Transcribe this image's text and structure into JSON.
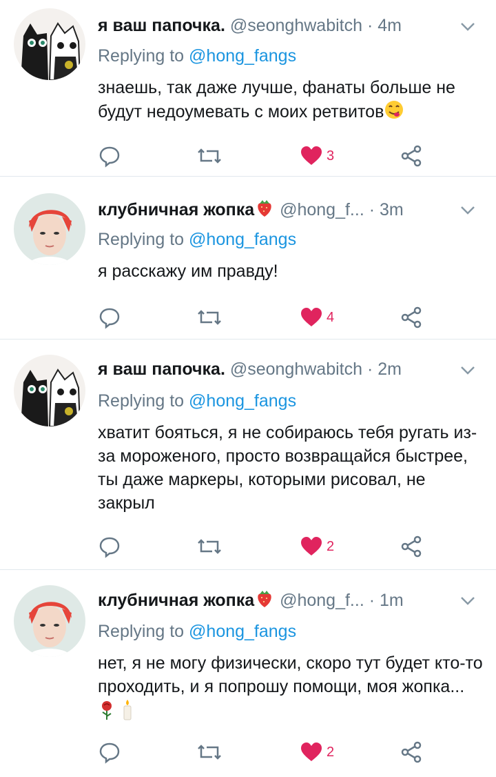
{
  "tweets": [
    {
      "name": "я ваш папочка.",
      "handle": "@seonghwabitch",
      "sep": "·",
      "time": "4m",
      "reply_label": "Replying to",
      "reply_to": "@hong_fangs",
      "text": "знаешь, так даже лучше, фанаты больше не будут недоумевать с моих ретвитов",
      "likes": "3",
      "avatar": "cats-avatar"
    },
    {
      "name": "клубничная жопка",
      "handle": "@hong_f...",
      "sep": "·",
      "time": "3m",
      "reply_label": "Replying to",
      "reply_to": "@hong_fangs",
      "text": "я расскажу им правду!",
      "likes": "4",
      "avatar": "red-hair-avatar"
    },
    {
      "name": "я ваш папочка.",
      "handle": "@seonghwabitch",
      "sep": "·",
      "time": "2m",
      "reply_label": "Replying to",
      "reply_to": "@hong_fangs",
      "text": "хватит бояться, я не собираюсь тебя ругать из-за мороженого, просто возвращайся быстрее, ты даже маркеры, которыми  рисовал, не закрыл",
      "likes": "2",
      "avatar": "cats-avatar"
    },
    {
      "name": "клубничная жопка",
      "handle": "@hong_f...",
      "sep": "·",
      "time": "1m",
      "reply_label": "Replying to",
      "reply_to": "@hong_fangs",
      "text": "нет, я не могу физически, скоро тут будет кто-то проходить, и я попрошу помощи, моя жопка...",
      "likes": "2",
      "avatar": "red-hair-avatar"
    }
  ],
  "icons": {
    "reply": "reply-icon",
    "retweet": "retweet-icon",
    "like": "heart-icon",
    "share": "share-icon",
    "more": "chevron-down-icon",
    "emoji_1": "yum-face-emoji",
    "emoji_2": "strawberry-emoji",
    "emoji_3": "rose-emoji",
    "emoji_4": "candle-emoji"
  },
  "colors": {
    "link": "#1b95e0",
    "muted": "#657786",
    "like": "#e0245e",
    "divider": "#e1e8ed"
  }
}
